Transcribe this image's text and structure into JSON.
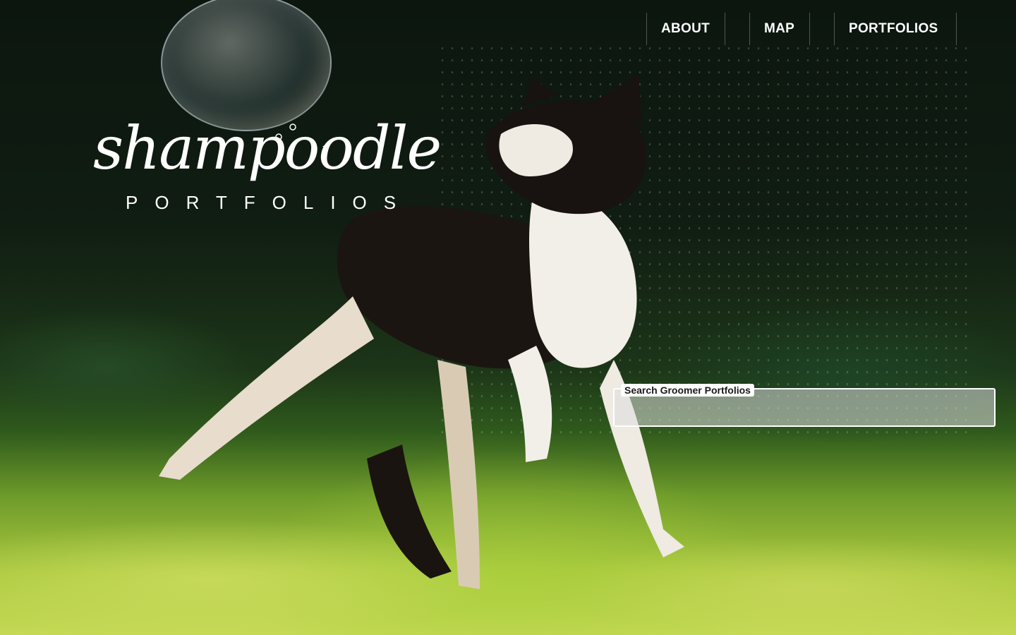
{
  "nav": {
    "items": [
      {
        "label": "ABOUT"
      },
      {
        "label": "MAP"
      },
      {
        "label": "PORTFOLIOS"
      }
    ]
  },
  "logo": {
    "script": "shampoodle",
    "subtitle": "PORTFOLIOS"
  },
  "search": {
    "label": "Search Groomer Portfolios",
    "value": "",
    "placeholder": ""
  },
  "colors": {
    "nav_text": "#ffffff",
    "search_border": "#ffffff",
    "search_label_bg": "#ffffff"
  }
}
